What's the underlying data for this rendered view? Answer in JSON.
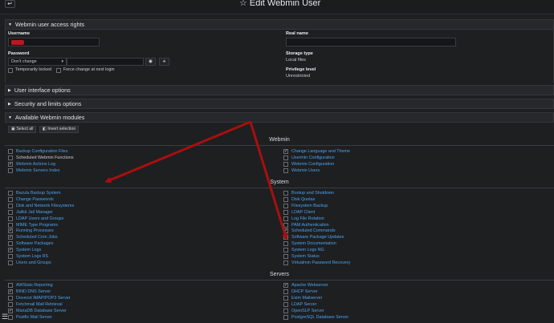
{
  "header": {
    "back_icon": "arrow-left-icon",
    "star_icon": "star-outline-icon",
    "title": "Edit Webmin User"
  },
  "access_rights": {
    "heading": "Webmin user access rights",
    "username_label": "Username",
    "realname_label": "Real name",
    "password_label": "Password",
    "password_mode": "Don't change",
    "storage_label": "Storage type",
    "storage_value": "Local files",
    "privilege_label": "Privilege level",
    "privilege_value": "Unrestricted",
    "temp_locked_label": "Temporarily locked",
    "force_change_label": "Force change at next login"
  },
  "collapsed_sections": [
    {
      "label": "User interface options"
    },
    {
      "label": "Security and limits options"
    }
  ],
  "modules_section": {
    "heading": "Available Webmin modules",
    "select_all": "Select all",
    "invert_selection": "Invert selection",
    "groups": [
      {
        "title": "Webmin",
        "left": [
          {
            "name": "Backup Configuration Files",
            "checked": false,
            "link": true
          },
          {
            "name": "Scheduled Webmin Functions",
            "checked": false,
            "link": false
          },
          {
            "name": "Webmin Actions Log",
            "checked": true,
            "link": true
          },
          {
            "name": "Webmin Servers Index",
            "checked": false,
            "link": true
          }
        ],
        "right": [
          {
            "name": "Change Language and Theme",
            "checked": true,
            "link": true
          },
          {
            "name": "Usermin Configuration",
            "checked": false,
            "link": true
          },
          {
            "name": "Webmin Configuration",
            "checked": false,
            "link": true
          },
          {
            "name": "Webmin Users",
            "checked": false,
            "link": true
          }
        ]
      },
      {
        "title": "System",
        "left": [
          {
            "name": "Bacula Backup System",
            "checked": false,
            "link": true
          },
          {
            "name": "Change Passwords",
            "checked": false,
            "link": true
          },
          {
            "name": "Disk and Network Filesystems",
            "checked": false,
            "link": true
          },
          {
            "name": "Jailkit Jail Manager",
            "checked": false,
            "link": true
          },
          {
            "name": "LDAP Users and Groups",
            "checked": false,
            "link": true
          },
          {
            "name": "MIME Type Programs",
            "checked": false,
            "link": true
          },
          {
            "name": "Running Processes",
            "checked": true,
            "link": true
          },
          {
            "name": "Scheduled Cron Jobs",
            "checked": true,
            "link": true
          },
          {
            "name": "Software Packages",
            "checked": false,
            "link": true
          },
          {
            "name": "System Logs",
            "checked": true,
            "link": true
          },
          {
            "name": "System Logs RS",
            "checked": false,
            "link": true
          },
          {
            "name": "Users and Groups",
            "checked": false,
            "link": true
          }
        ],
        "right": [
          {
            "name": "Bootup and Shutdown",
            "checked": false,
            "link": true
          },
          {
            "name": "Disk Quotas",
            "checked": false,
            "link": true
          },
          {
            "name": "Filesystem Backup",
            "checked": false,
            "link": true
          },
          {
            "name": "LDAP Client",
            "checked": false,
            "link": true
          },
          {
            "name": "Log File Rotation",
            "checked": false,
            "link": true
          },
          {
            "name": "PAM Authentication",
            "checked": false,
            "link": true
          },
          {
            "name": "Scheduled Commands",
            "checked": true,
            "link": true
          },
          {
            "name": "Software Package Updates",
            "checked": false,
            "link": true
          },
          {
            "name": "System Documentation",
            "checked": false,
            "link": true
          },
          {
            "name": "System Logs NG",
            "checked": false,
            "link": true
          },
          {
            "name": "System Status",
            "checked": false,
            "link": true
          },
          {
            "name": "Virtualmin Password Recovery",
            "checked": false,
            "link": true
          }
        ]
      },
      {
        "title": "Servers",
        "left": [
          {
            "name": "AWStats Reporting",
            "checked": false,
            "link": true
          },
          {
            "name": "BIND DNS Server",
            "checked": true,
            "link": true
          },
          {
            "name": "Dovecot IMAP/POP3 Server",
            "checked": false,
            "link": true
          },
          {
            "name": "Fetchmail Mail Retrieval",
            "checked": false,
            "link": true
          },
          {
            "name": "MariaDB Database Server",
            "checked": true,
            "link": true
          },
          {
            "name": "Postfix Mail Server",
            "checked": false,
            "link": true
          }
        ],
        "right": [
          {
            "name": "Apache Webserver",
            "checked": true,
            "link": true
          },
          {
            "name": "DHCP Server",
            "checked": false,
            "link": true
          },
          {
            "name": "Exim Mailserver",
            "checked": false,
            "link": true
          },
          {
            "name": "LDAP Server",
            "checked": false,
            "link": true
          },
          {
            "name": "OpenSLP Server",
            "checked": false,
            "link": true
          },
          {
            "name": "PostgreSQL Database Server",
            "checked": false,
            "link": true
          }
        ]
      }
    ]
  },
  "colors": {
    "accent_link": "#4aa3f0",
    "arrow": "#b01010",
    "background": "#1e1f21"
  }
}
